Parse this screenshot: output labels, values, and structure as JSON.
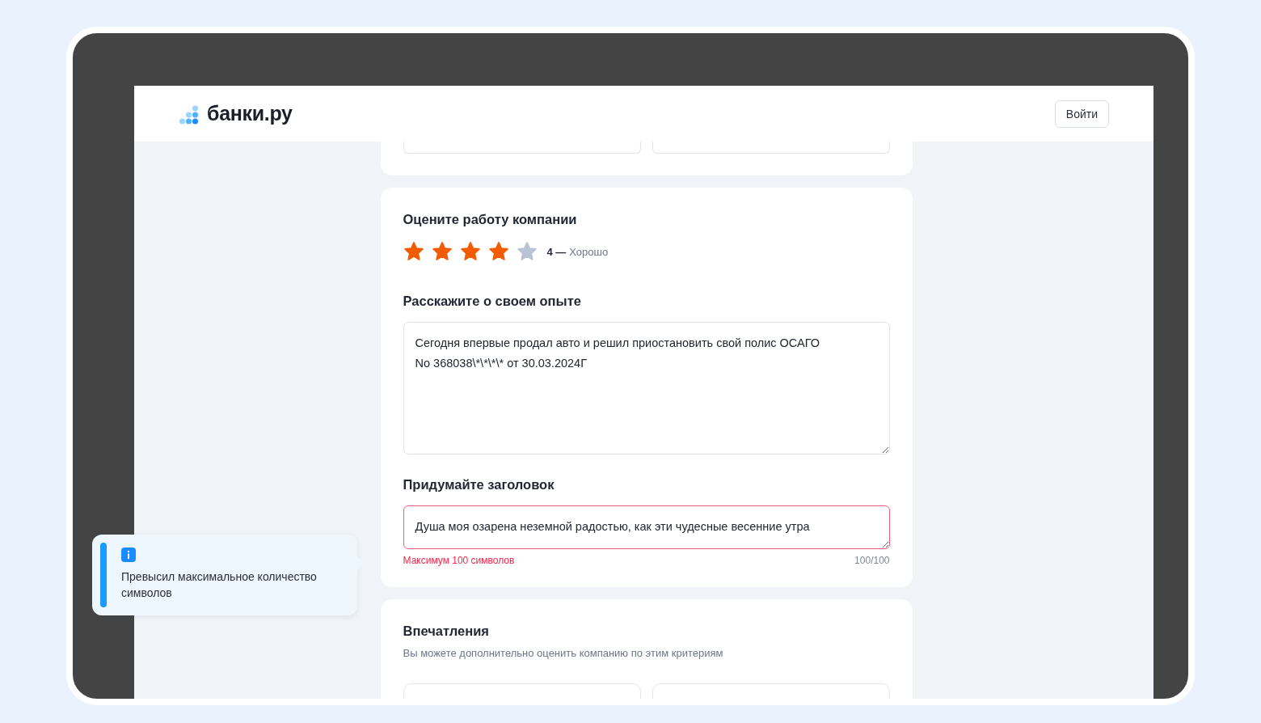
{
  "header": {
    "logo_text": "банки.ру",
    "login_button": "Войти"
  },
  "rating_section": {
    "title": "Оцените работу компании",
    "stars": 4,
    "score_text": "4 —",
    "rating_label": "Хорошо"
  },
  "experience": {
    "title": "Расскажите о своем опыте",
    "value": "Сегодня впервые продал авто и решил приостановить свой полис ОСАГО\nNo 368038\\*\\*\\*\\* от 30.03.2024Г"
  },
  "headline": {
    "title": "Придумайте заголовок",
    "value": "Душа моя озарена неземной радостью, как эти чудесные весенние утра",
    "error": true,
    "error_text": "Максимум 100 символов",
    "counter": "100/100"
  },
  "impressions": {
    "title": "Впечатления",
    "subtitle": "Вы можете дополнительно оценить компанию по этим критериям"
  },
  "toast": {
    "text": "Превысил максимальное количество символов"
  }
}
